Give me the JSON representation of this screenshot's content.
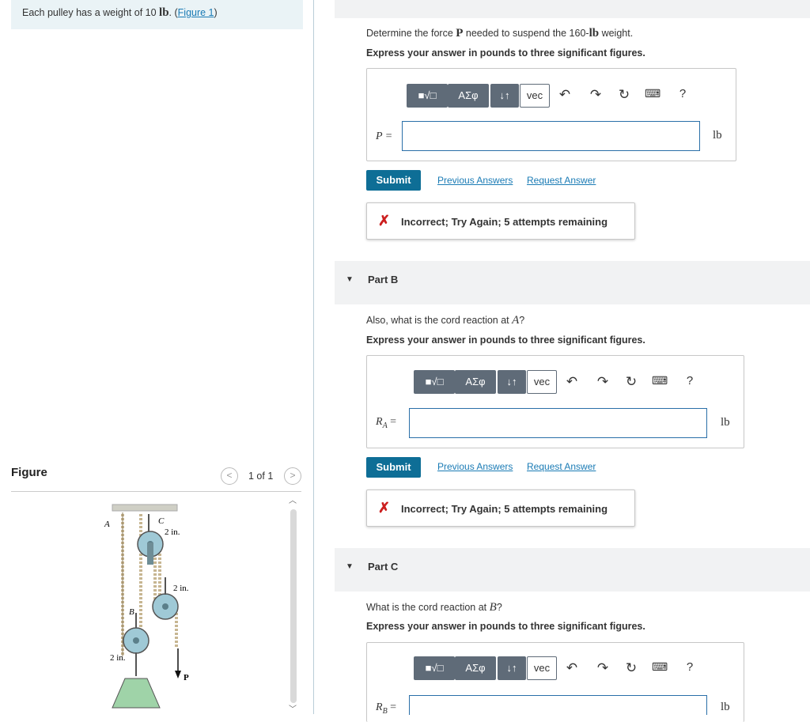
{
  "intro": {
    "text_before": "Each pulley has a weight of 10 ",
    "unit": "lb",
    "text_mid": ". (",
    "link": "Figure 1",
    "text_after": ")"
  },
  "figure": {
    "title": "Figure",
    "pager_prev": "<",
    "pager_text": "1 of 1",
    "pager_next": ">",
    "labels": {
      "A": "A",
      "B": "B",
      "C": "C",
      "dim1": "2 in.",
      "dim2": "2 in.",
      "dim3": "2 in.",
      "P": "P"
    }
  },
  "toolbar": {
    "templates_label": "■√□",
    "greek_label": "ΑΣφ",
    "sort_label": "↓↑",
    "vec_label": "vec",
    "help_label": "?"
  },
  "common": {
    "instruction": "Express your answer in pounds to three significant figures.",
    "submit": "Submit",
    "previous_answers": "Previous Answers",
    "request_answer": "Request Answer",
    "unit": "lb",
    "feedback_icon": "✗",
    "feedback": "Incorrect; Try Again; 5 attempts remaining",
    "caret": "▼"
  },
  "partA": {
    "question_before": "Determine the force ",
    "question_sym": "P",
    "question_after": " needed to suspend the 160-",
    "question_unit": "lb",
    "question_end": " weight.",
    "label": "P =",
    "value": ""
  },
  "partB": {
    "title": "Part B",
    "question_before": "Also, what is the cord reaction at ",
    "question_sym": "A",
    "question_after": "?",
    "label_var": "R",
    "label_sub": "A",
    "label_eq": " =",
    "value": ""
  },
  "partC": {
    "title": "Part C",
    "question_before": "What is the cord reaction at ",
    "question_sym": "B",
    "question_after": "?",
    "label_var": "R",
    "label_sub": "B",
    "label_eq": " =",
    "value": ""
  }
}
